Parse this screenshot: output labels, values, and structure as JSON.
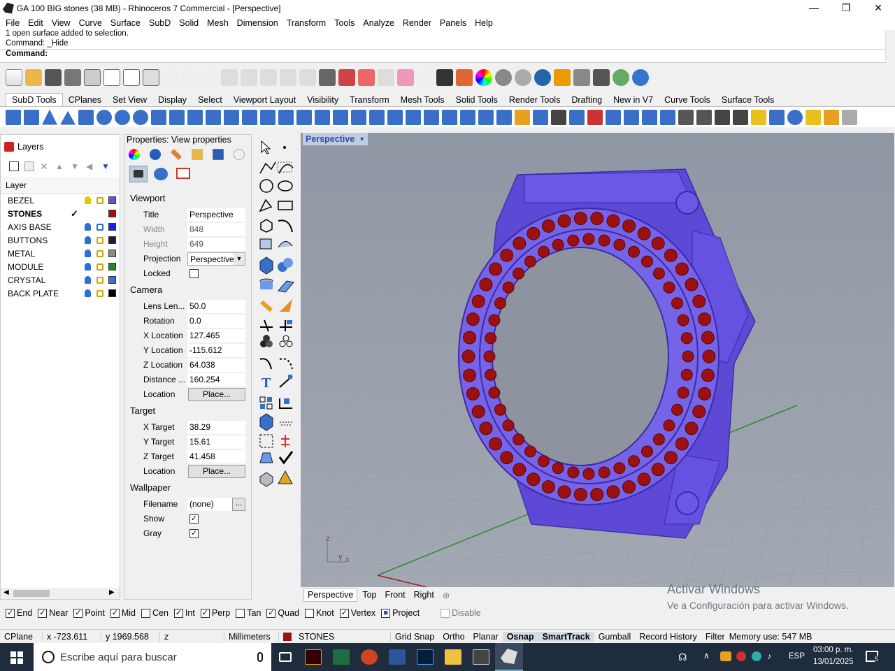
{
  "window": {
    "title": "GA 100 BIG stones (38 MB) - Rhinoceros 7 Commercial - [Perspective]",
    "controls": [
      "minimize",
      "restore",
      "close"
    ]
  },
  "menu": [
    "File",
    "Edit",
    "View",
    "Curve",
    "Surface",
    "SubD",
    "Solid",
    "Mesh",
    "Dimension",
    "Transform",
    "Tools",
    "Analyze",
    "Render",
    "Panels",
    "Help"
  ],
  "command": {
    "history_line1": "1 open surface added to selection.",
    "history_line2": "Command: _Hide",
    "prompt": "Command:"
  },
  "toolbar_tabs": [
    "SubD Tools",
    "CPlanes",
    "Set View",
    "Display",
    "Select",
    "Viewport Layout",
    "Visibility",
    "Transform",
    "Mesh Tools",
    "Solid Tools",
    "Render Tools",
    "Drafting",
    "New in V7",
    "Curve Tools",
    "Surface Tools"
  ],
  "layers": {
    "title": "Layers",
    "column_header": "Layer",
    "items": [
      {
        "name": "BEZEL",
        "color": "#6a4fd1",
        "current": false,
        "bulb_color": "#e6c800"
      },
      {
        "name": "STONES",
        "color": "#9b1111",
        "current": true,
        "check": "✓"
      },
      {
        "name": "AXIS BASE",
        "color": "#1d1df0",
        "current": false
      },
      {
        "name": "BUTTONS",
        "color": "#1a1a4a",
        "current": false
      },
      {
        "name": "METAL",
        "color": "#8a8a8a",
        "current": false
      },
      {
        "name": "MODULE",
        "color": "#1e8a1e",
        "current": false
      },
      {
        "name": "CRYSTAL",
        "color": "#3b6fd8",
        "current": false
      },
      {
        "name": "BACK PLATE",
        "color": "#000000",
        "current": false
      }
    ]
  },
  "properties": {
    "title": "Properties: View properties",
    "viewport": {
      "section": "Viewport",
      "title_label": "Title",
      "title_value": "Perspective",
      "width_label": "Width",
      "width_value": "848",
      "height_label": "Height",
      "height_value": "649",
      "projection_label": "Projection",
      "projection_value": "Perspective",
      "locked_label": "Locked"
    },
    "camera": {
      "section": "Camera",
      "lens_label": "Lens Len...",
      "lens_value": "50.0",
      "rotation_label": "Rotation",
      "rotation_value": "0.0",
      "xloc_label": "X Location",
      "xloc_value": "127.465",
      "yloc_label": "Y Location",
      "yloc_value": "-115.612",
      "zloc_label": "Z Location",
      "zloc_value": "64.038",
      "dist_label": "Distance ...",
      "dist_value": "160.254",
      "location_label": "Location",
      "place_button": "Place..."
    },
    "target": {
      "section": "Target",
      "xt_label": "X Target",
      "xt_value": "38.29",
      "yt_label": "Y Target",
      "yt_value": "15.61",
      "zt_label": "Z Target",
      "zt_value": "41.458",
      "location_label": "Location",
      "place_button": "Place..."
    },
    "wallpaper": {
      "section": "Wallpaper",
      "filename_label": "Filename",
      "filename_value": "(none)",
      "browse": "...",
      "show_label": "Show",
      "show_checked": "✓",
      "gray_label": "Gray",
      "gray_checked": "✓"
    }
  },
  "viewport": {
    "label": "Perspective",
    "axis_z": "z",
    "axis_y": "y",
    "axis_x": "x",
    "tabs": [
      "Perspective",
      "Top",
      "Front",
      "Right"
    ],
    "watermark_line1": "Activar Windows",
    "watermark_line2": "Ve a Configuración para activar Windows."
  },
  "osnap": [
    {
      "label": "End",
      "checked": "✓"
    },
    {
      "label": "Near",
      "checked": "✓"
    },
    {
      "label": "Point",
      "checked": "✓"
    },
    {
      "label": "Mid",
      "checked": "✓"
    },
    {
      "label": "Cen",
      "checked": ""
    },
    {
      "label": "Int",
      "checked": "✓"
    },
    {
      "label": "Perp",
      "checked": "✓"
    },
    {
      "label": "Tan",
      "checked": ""
    },
    {
      "label": "Quad",
      "checked": "✓"
    },
    {
      "label": "Knot",
      "checked": ""
    },
    {
      "label": "Vertex",
      "checked": "✓"
    },
    {
      "label": "Project",
      "checked": "■"
    },
    {
      "label": "Disable",
      "checked": ""
    }
  ],
  "status": {
    "cplane": "CPlane",
    "x": "x -723.611",
    "y": "y 1969.568",
    "z": "z",
    "units": "Millimeters",
    "layer": "STONES",
    "layer_color": "#9b1111",
    "grid_snap": "Grid Snap",
    "ortho": "Ortho",
    "planar": "Planar",
    "osnap": "Osnap",
    "smarttrack": "SmartTrack",
    "gumball": "Gumball",
    "record_history": "Record History",
    "filter": "Filter",
    "memory": "Memory use: 547 MB"
  },
  "taskbar": {
    "search_placeholder": "Escribe aquí para buscar",
    "language": "ESP",
    "time": "03:00 p. m.",
    "date": "13/01/2025",
    "notifications": "5"
  }
}
